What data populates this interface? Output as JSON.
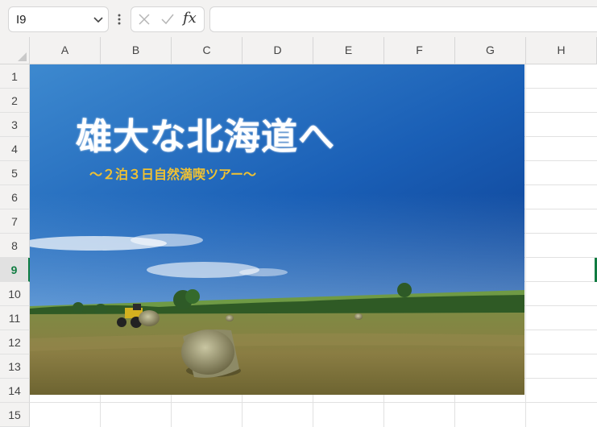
{
  "formula_bar": {
    "name_box": "I9",
    "fx_label": "fx",
    "formula": ""
  },
  "columns": [
    "A",
    "B",
    "C",
    "D",
    "E",
    "F",
    "G",
    "H"
  ],
  "rows": [
    "1",
    "2",
    "3",
    "4",
    "5",
    "6",
    "7",
    "8",
    "9",
    "10",
    "11",
    "12",
    "13",
    "14",
    "15"
  ],
  "active_cell": "I9",
  "picture": {
    "title": "雄大な北海道へ",
    "subtitle": "～２泊３日自然満喫ツアー～"
  },
  "colors": {
    "accent": "#107c41",
    "subtitle": "#f1c232"
  }
}
